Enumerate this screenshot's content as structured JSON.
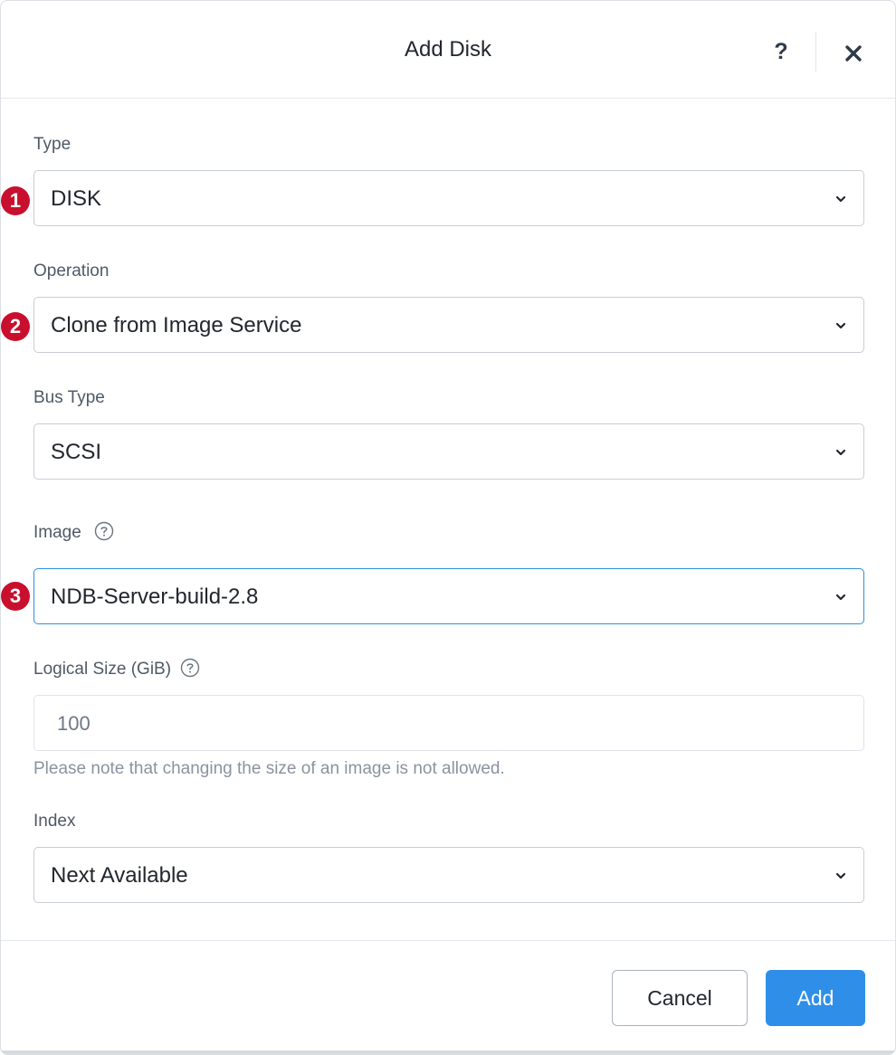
{
  "dialog": {
    "title": "Add Disk",
    "help_label": "?",
    "close_icon": "close-icon"
  },
  "fields": {
    "type": {
      "label": "Type",
      "value": "DISK",
      "badge": "1"
    },
    "operation": {
      "label": "Operation",
      "value": "Clone from Image Service",
      "badge": "2"
    },
    "bus_type": {
      "label": "Bus Type",
      "value": "SCSI"
    },
    "image": {
      "label": "Image",
      "value": "NDB-Server-build-2.8",
      "badge": "3"
    },
    "logical_size": {
      "label": "Logical Size (GiB)",
      "value": "100",
      "hint": "Please note that changing the size of an image is not allowed."
    },
    "index": {
      "label": "Index",
      "value": "Next Available"
    }
  },
  "footer": {
    "cancel_label": "Cancel",
    "add_label": "Add"
  },
  "colors": {
    "primary": "#2f8fe8",
    "badge": "#c8102e",
    "focus_border": "#2f8fe0"
  }
}
